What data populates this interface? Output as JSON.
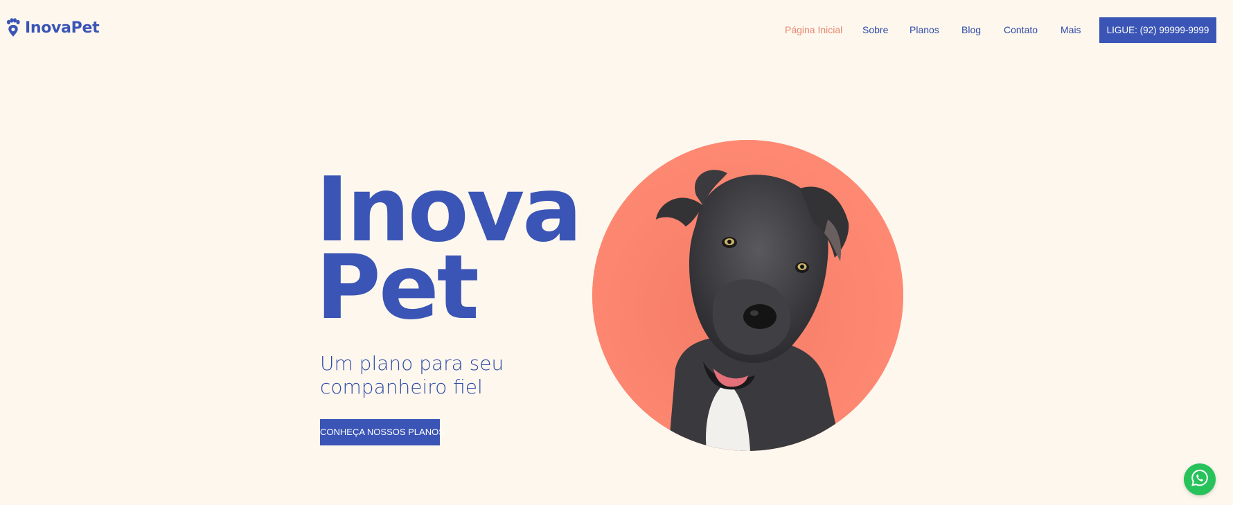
{
  "header": {
    "logo_text": "InovaPet",
    "logo_icon": "paw-pin-icon",
    "nav": [
      {
        "label": "Página Inicial",
        "active": true
      },
      {
        "label": "Sobre",
        "active": false
      },
      {
        "label": "Planos",
        "active": false
      },
      {
        "label": "Blog",
        "active": false
      },
      {
        "label": "Contato",
        "active": false
      },
      {
        "label": "Mais",
        "active": false
      }
    ],
    "call_button_label": "LIGUE: (92) 99999-9999"
  },
  "hero": {
    "title_line1": "Inova",
    "title_line2": "Pet",
    "subtitle_line1": "Um plano para seu",
    "subtitle_line2": "companheiro fiel",
    "cta_label": "CONHEÇA NOSSOS PLANOS",
    "image": "dog-photo"
  },
  "floating": {
    "whatsapp_icon": "whatsapp-icon"
  },
  "colors": {
    "background": "#fef7ee",
    "brand_blue": "#3a55b5",
    "accent_salmon": "#fa8670",
    "nav_active": "#e7876f",
    "whatsapp_green": "#28c25a"
  }
}
